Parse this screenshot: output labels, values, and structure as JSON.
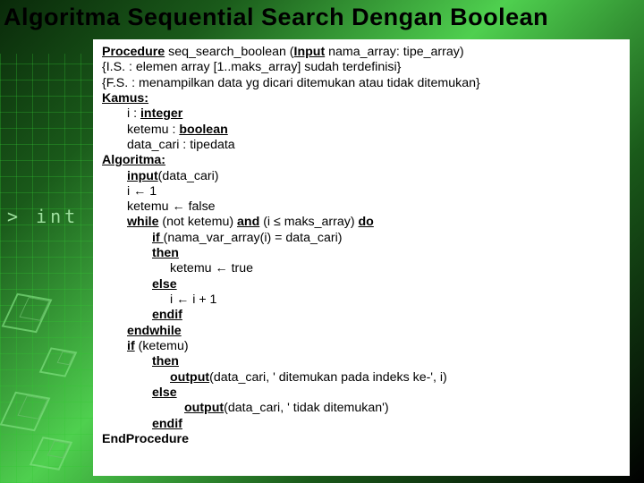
{
  "title": "Algoritma Sequential Search Dengan Boolean",
  "background_prompt": "> int",
  "code": {
    "l1a": "Procedure",
    "l1b": "  seq_search_boolean (",
    "l1c": "Input",
    "l1d": "  nama_array: tipe_array)",
    "l2": "{I.S. : elemen array [1..maks_array] sudah terdefinisi}",
    "l3": "{F.S. : menampilkan data yg dicari ditemukan atau tidak ditemukan}",
    "l4": "Kamus:",
    "l5a": "i : ",
    "l5b": "integer",
    "l6a": "ketemu : ",
    "l6b": "boolean",
    "l7": "data_cari : tipedata",
    "l8": "Algoritma:",
    "l9a": "input",
    "l9b": "(data_cari)",
    "l10": "i ← 1",
    "l11": "ketemu ← false",
    "l12a": "while",
    "l12b": " (not ketemu) ",
    "l12c": "and",
    "l12d": " (i ≤ maks_array) ",
    "l12e": "do",
    "l13a": "if ",
    "l13b": "(nama_var_array(i) = data_cari)",
    "l14": "then",
    "l15": "ketemu ←  true",
    "l16": "else",
    "l17": "i ←  i + 1",
    "l18": "endif",
    "l19": "endwhile",
    "l20a": "if",
    "l20b": " (ketemu)",
    "l21": "then",
    "l22a": "output",
    "l22b": "(data_cari, ' ditemukan pada indeks ke-', i)",
    "l23": "else",
    "l24a": "output",
    "l24b": "(data_cari, ' tidak ditemukan')",
    "l25": "endif",
    "l26": "EndProcedure"
  }
}
